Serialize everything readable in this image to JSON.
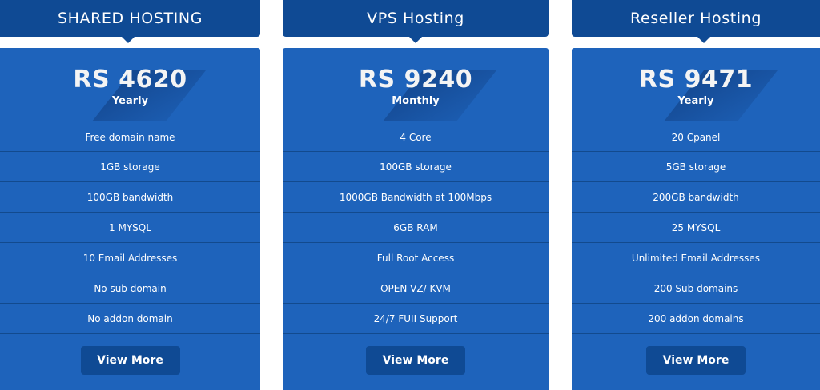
{
  "plans": [
    {
      "title": "SHARED HOSTING",
      "price": "RS 4620",
      "period": "Yearly",
      "features": [
        "Free domain name",
        "1GB storage",
        "100GB bandwidth",
        "1 MYSQL",
        "10 Email Addresses",
        "No sub domain",
        "No addon domain"
      ],
      "button_label": "View More"
    },
    {
      "title": "VPS Hosting",
      "price": "RS 9240",
      "period": "Monthly",
      "features": [
        "4 Core",
        "100GB storage",
        "1000GB Bandwidth at 100Mbps",
        "6GB RAM",
        "Full Root Access",
        "OPEN VZ/ KVM",
        "24/7 FUII Support"
      ],
      "button_label": "View More"
    },
    {
      "title": "Reseller Hosting",
      "price": "RS 9471",
      "period": "Yearly",
      "features": [
        "20 Cpanel",
        "5GB storage",
        "200GB bandwidth",
        "25 MYSQL",
        "Unlimited Email Addresses",
        "200 Sub domains",
        "200 addon domains"
      ],
      "button_label": "View More"
    }
  ],
  "colors": {
    "header": "#0f4a94",
    "card": "#1e63bb",
    "divider": "#124a8e",
    "text": "#ffffff"
  }
}
